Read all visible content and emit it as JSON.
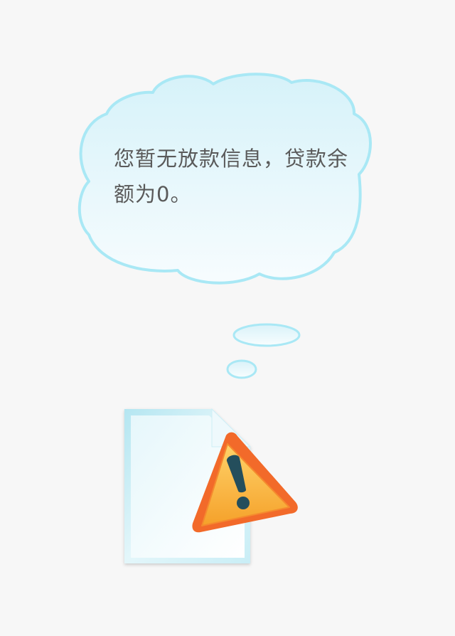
{
  "empty_state": {
    "message": "您暂无放款信息，贷款余额为0。",
    "icon": "document-warning-icon"
  },
  "colors": {
    "background": "#f7f7f7",
    "cloud_fill_top": "#d6f2f9",
    "cloud_fill_bottom": "#f7fcfe",
    "cloud_outline": "#a9e8f5",
    "text": "#5a5a5a",
    "warning_orange": "#f7a12a",
    "warning_dark": "#244e5c"
  }
}
